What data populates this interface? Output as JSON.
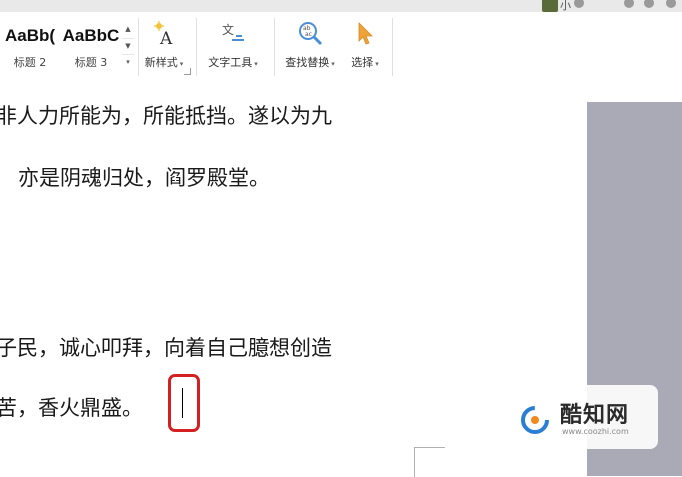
{
  "topbar": {
    "user_text": "小",
    "icons": [
      "help-icon",
      "settings-icon",
      "share-icon",
      "menu-icon"
    ]
  },
  "ribbon": {
    "styles": [
      {
        "sample": "AaBb(",
        "label": "标题 2"
      },
      {
        "sample": "AaBbC",
        "label": "标题 3"
      }
    ],
    "scroll_up": "▲",
    "scroll_down": "▼",
    "scroll_more": "▾",
    "new_style_label": "新样式",
    "text_tools_label": "文字工具",
    "find_replace_label": "查找替换",
    "select_label": "选择",
    "dropdown_glyph": "▾"
  },
  "document": {
    "lines": [
      "非人力所能为，所能抵挡。遂以为九",
      "亦是阴魂归处，阎罗殿堂。",
      "子民，诚心叩拜，向着自己臆想创造",
      "苦，香火鼎盛。"
    ]
  },
  "watermark": {
    "brand": "酷知网",
    "url": "www.coozhi.com"
  },
  "colors": {
    "highlight": "#d42020",
    "side_panel": "#aaaab6",
    "ribbon_bg": "#ffffff"
  }
}
